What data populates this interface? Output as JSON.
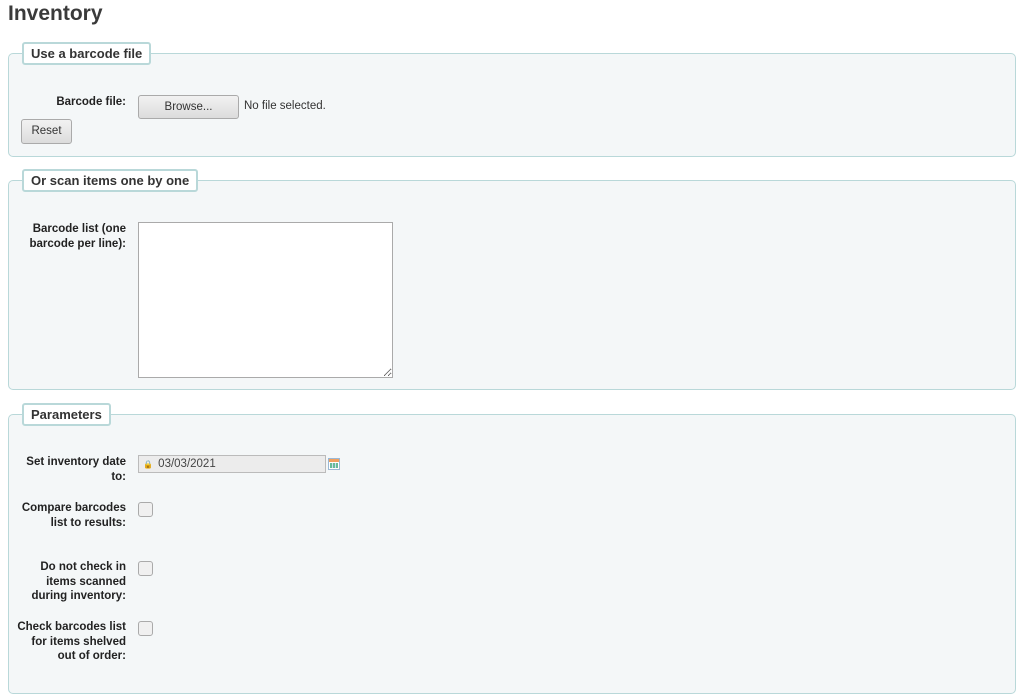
{
  "page": {
    "title": "Inventory"
  },
  "barcode_file_section": {
    "legend": "Use a barcode file",
    "field_label": "Barcode file:",
    "browse_label": "Browse...",
    "file_status": "No file selected.",
    "reset_label": "Reset"
  },
  "scan_section": {
    "legend": "Or scan items one by one",
    "field_label": "Barcode list (one barcode per line):",
    "textarea_value": ""
  },
  "parameters_section": {
    "legend": "Parameters",
    "date_label": "Set inventory date to:",
    "date_value": "03/03/2021",
    "checkboxes": [
      {
        "label": "Compare barcodes list to results:",
        "checked": false
      },
      {
        "label": "Do not check in items scanned during inventory:",
        "checked": false
      },
      {
        "label": "Check barcodes list for items shelved out of order:",
        "checked": false
      }
    ]
  }
}
